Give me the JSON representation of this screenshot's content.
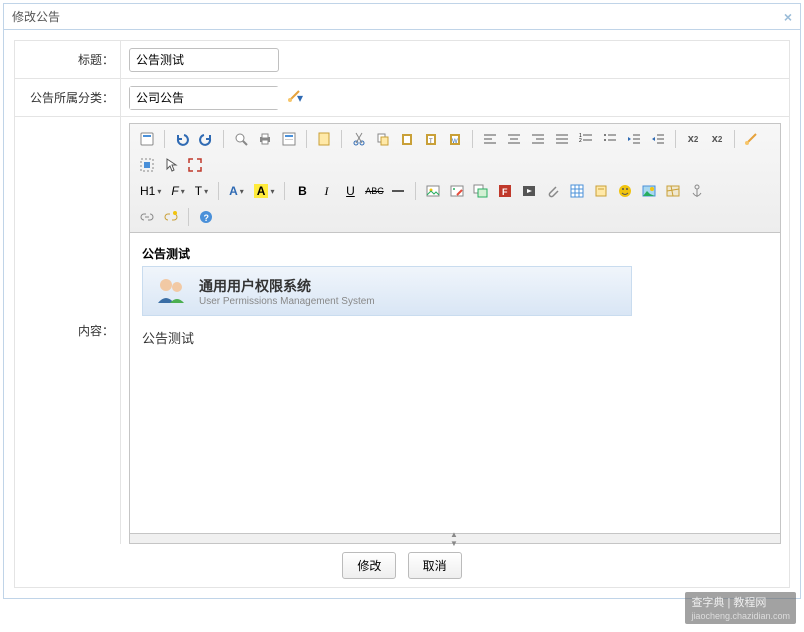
{
  "dialog": {
    "title": "修改公告"
  },
  "form": {
    "title_label": "标题：",
    "title_value": "公告测试",
    "category_label": "公告所属分类：",
    "category_value": "公司公告",
    "content_label": "内容："
  },
  "editor": {
    "dropdowns": {
      "heading": "H1",
      "font_family": "F",
      "font_size": "T",
      "font_color": "A",
      "highlight": "A"
    },
    "content": {
      "title": "公告测试",
      "banner_main": "通用用户权限系统",
      "banner_sub": "User Permissions Management System",
      "body": "公告测试"
    }
  },
  "buttons": {
    "submit": "修改",
    "cancel": "取消"
  },
  "watermark": {
    "main": "查字典 | 教程网",
    "sub": "jiaocheng.chazidian.com"
  },
  "icons": {
    "source": "source-icon",
    "undo": "undo-icon",
    "redo": "redo-icon",
    "preview": "preview-icon",
    "print": "print-icon",
    "template": "template-icon",
    "newpage": "newpage-icon",
    "cut": "cut-icon",
    "copy": "copy-icon",
    "paste": "paste-icon",
    "paste_text": "paste-text-icon",
    "paste_word": "paste-word-icon",
    "align_left": "align-left-icon",
    "align_center": "align-center-icon",
    "align_right": "align-right-icon",
    "align_justify": "align-justify-icon",
    "ol": "ordered-list-icon",
    "ul": "unordered-list-icon",
    "outdent": "outdent-icon",
    "indent": "indent-icon",
    "sub": "subscript-icon",
    "sup": "superscript-icon",
    "clear_format": "clear-format-icon",
    "select_all": "select-all-icon",
    "cursor": "cursor-icon",
    "fullscreen": "fullscreen-icon",
    "bold": "B",
    "italic": "I",
    "underline": "U",
    "strike": "ABC",
    "hr": "hr-icon",
    "image": "image-icon",
    "image_edit": "image-edit-icon",
    "multi_image": "multi-image-icon",
    "flash": "flash-icon",
    "media": "media-icon",
    "attach": "attach-icon",
    "table": "table-icon",
    "more": "more-icon",
    "emoji": "emoji-icon",
    "picture": "picture-icon",
    "map": "map-icon",
    "anchor": "anchor-icon",
    "link": "link-icon",
    "link_style": "link-style-icon",
    "help": "help-icon"
  }
}
